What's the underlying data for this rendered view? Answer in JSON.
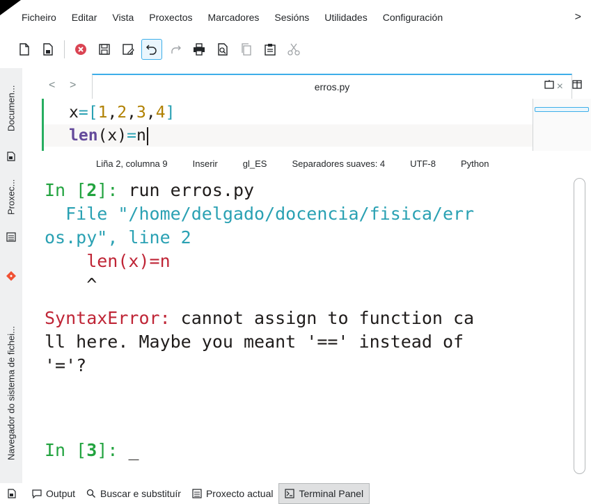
{
  "menubar": {
    "items": [
      "Ficheiro",
      "Editar",
      "Vista",
      "Proxectos",
      "Marcadores",
      "Sesións",
      "Utilidades",
      "Configuración"
    ],
    "more": ">"
  },
  "toolbar": {
    "buttons": [
      "new-document-icon",
      "open-document-icon",
      "close-icon",
      "save-icon",
      "save-as-icon",
      "undo-icon",
      "redo-icon",
      "print-icon",
      "print-preview-icon",
      "copy-icon",
      "paste-icon",
      "cut-icon"
    ]
  },
  "leftdock": {
    "tab_documents": "Documen...",
    "tab_projects": "Proxec...",
    "tab_filesystem": "Navegador do sistema de fichei..."
  },
  "tabbar": {
    "back": "<",
    "forward": ">",
    "tab_label": "erros.py",
    "close": "×"
  },
  "editor": {
    "line1": {
      "x": "x",
      "eq": "=",
      "open": "[",
      "nums": [
        "1",
        "2",
        "3",
        "4"
      ],
      "close": "]"
    },
    "line2": {
      "fn": "len",
      "arg": "(x)",
      "eq": "=",
      "rest": "n"
    }
  },
  "statusbar": {
    "position": "Liña 2, columna 9",
    "mode": "Inserir",
    "language_dict": "gl_ES",
    "indent": "Separadores suaves: 4",
    "encoding": "UTF-8",
    "syntax": "Python"
  },
  "terminal": {
    "prompt_in": "In [",
    "prompt_num_2": "2",
    "prompt_close": "]: ",
    "command": "run erros.py",
    "file_line_a": "  File \"/home/delgado/docencia/fisica/err",
    "file_line_b": "os.py\"",
    "file_line_b2": ", line ",
    "file_line_b3": "2",
    "code_line": "    len(x)=n",
    "caret_line": "    ^",
    "error_type": "SyntaxError:",
    "error_msg_a": " cannot assign to function ca",
    "error_msg_b": "ll here. Maybe you meant '==' instead of",
    "error_msg_c": "'='?",
    "prompt_num_3": "3",
    "cursor": "_"
  },
  "bottombar": {
    "output": "Output",
    "search": "Buscar e substituír",
    "project": "Proxecto actual",
    "terminal": "Terminal Panel"
  },
  "colors": {
    "accent": "#3daee9",
    "modified_bar": "#27ae60",
    "prompt_green": "#22a33f",
    "string_cyan": "#2aa1b3",
    "error_red": "#bf2536"
  }
}
